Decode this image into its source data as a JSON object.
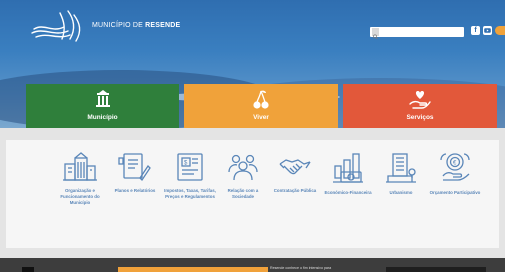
{
  "header": {
    "brand_prefix": "MUNICÍPIO DE ",
    "brand_name": "RESENDE",
    "search_placeholder": "",
    "social_icons": [
      "facebook-icon",
      "youtube-icon",
      "accessibility-icon"
    ]
  },
  "tiles": [
    {
      "label": "Município",
      "icon": "monument-icon",
      "color": "#2f7f3b"
    },
    {
      "label": "Viver",
      "icon": "cherries-icon",
      "color": "#f0a23a"
    },
    {
      "label": "Serviços",
      "icon": "hand-heart-icon",
      "color": "#e2583a"
    }
  ],
  "services": [
    {
      "label": "Organização e Funcionamento do Município",
      "icon": "building-icon"
    },
    {
      "label": "Planos e Relatórios",
      "icon": "document-pencil-icon"
    },
    {
      "label": "Impostos, Taxas, Tarifas, Preços e Regulamentos",
      "icon": "invoice-icon"
    },
    {
      "label": "Relação com a Sociedade",
      "icon": "people-icon"
    },
    {
      "label": "Contratação Pública",
      "icon": "handshake-icon"
    },
    {
      "label": "Económico-Financeira",
      "icon": "finance-chart-icon"
    },
    {
      "label": "Urbanismo",
      "icon": "urban-building-icon"
    },
    {
      "label": "Orçamento Participativo",
      "icon": "participatory-budget-icon"
    }
  ],
  "footer_strip": {
    "snippet": "Resende conhece o fim intensivo para"
  },
  "colors": {
    "hero_blue": "#2f6eb0",
    "service_blue": "#5a86b8",
    "panel_bg": "#f6f6f6"
  }
}
